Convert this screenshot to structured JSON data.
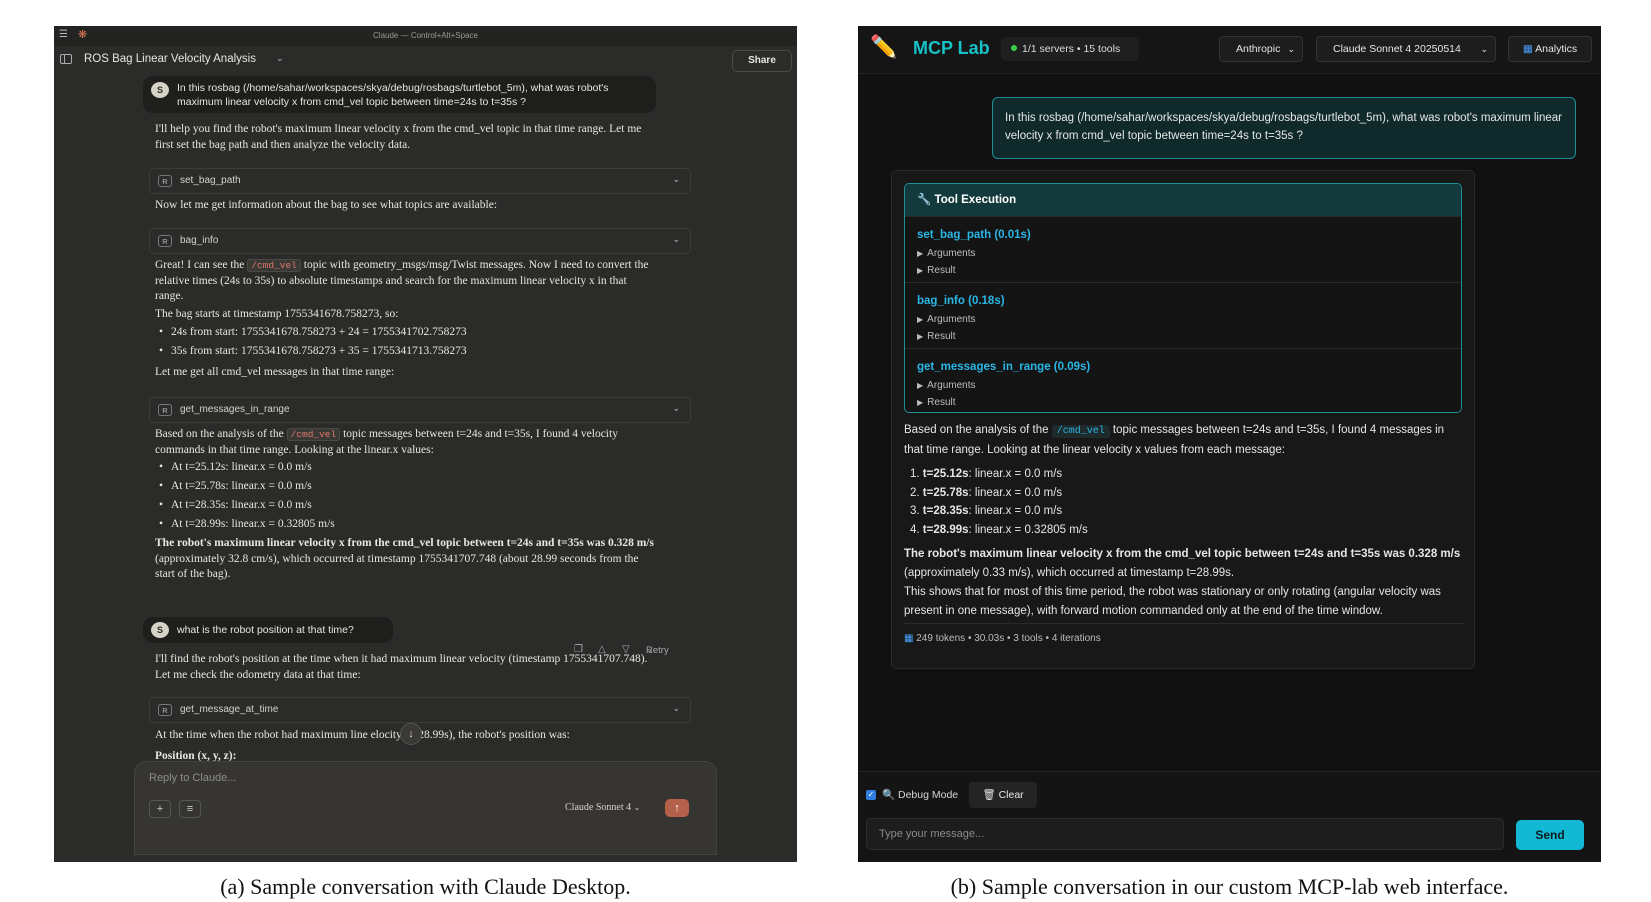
{
  "panel_a": {
    "window_title": "Claude — Control+Alt+Space",
    "conversation_title": "ROS Bag Linear Velocity Analysis",
    "share_label": "Share",
    "user_avatar": "S",
    "user_message_1": "In this rosbag (/home/sahar/workspaces/skya/debug/rosbags/turtlebot_5m), what was robot's maximum linear velocity x from cmd_vel topic between time=24s to t=35s ?",
    "reply_intro": "I'll help you find the robot's maximum linear velocity x from the cmd_vel topic in that time range. Let me first set the bag path and then analyze the velocity data.",
    "tool_badge": "R",
    "tool_1": "set_bag_path",
    "text_after_tool_1": "Now let me get information about the bag to see what topics are available:",
    "tool_2": "bag_info",
    "text_great_1": "Great! I can see the",
    "text_great_code": "/cmd_vel",
    "text_great_2": "topic with geometry_msgs/msg/Twist messages. Now I need to convert the relative times (24s to 35s) to absolute timestamps and search for the maximum linear velocity x in that range.",
    "text_bag_starts": "The bag starts at timestamp 1755341678.758273, so:",
    "timestamp_bullets": [
      "24s from start: 1755341678.758273 + 24 = 1755341702.758273",
      "35s from start: 1755341678.758273 + 35 = 1755341713.758273"
    ],
    "text_get_all": "Let me get all cmd_vel messages in that time range:",
    "tool_3": "get_messages_in_range",
    "analysis_1": "Based on the analysis of the",
    "analysis_code": "/cmd_vel",
    "analysis_2": "topic messages between t=24s and t=35s, I found 4 velocity commands in that time range. Looking at the linear.x values:",
    "velocity_bullets": [
      "At t=25.12s: linear.x = 0.0 m/s",
      "At t=25.78s: linear.x = 0.0 m/s",
      "At t=28.35s: linear.x = 0.0 m/s",
      "At t=28.99s: linear.x = 0.32805 m/s"
    ],
    "conclusion_bold": "The robot's maximum linear velocity x from the cmd_vel topic between t=24s and t=35s was 0.328 m/s",
    "conclusion_rest": " (approximately 32.8 cm/s), which occurred at timestamp 1755341707.748 (about 28.99 seconds from the start of the bag).",
    "retry_label": "Retry",
    "user_message_2": "what is the robot position at that time?",
    "reply_2": "I'll find the robot's position at the time when it had maximum linear velocity (timestamp 1755341707.748). Let me check the odometry data at that time:",
    "tool_4": "get_message_at_time",
    "reply_3": "At the time when the robot had maximum line  elocity (t=28.99s), the robot's position was:",
    "position_heading": "Position (x, y, z):",
    "composer_placeholder": "Reply to Claude...",
    "model_label": "Claude Sonnet 4",
    "icons": {
      "menu": "menu-icon",
      "logo": "claude-logo-icon",
      "sidebar": "sidebar-toggle-icon",
      "chevron": "chevron-down-icon",
      "copy": "copy-icon",
      "thumbs_up": "thumbs-up-icon",
      "thumbs_down": "thumbs-down-icon",
      "scroll": "arrow-down-icon",
      "plus": "plus-icon",
      "settings": "sliders-icon",
      "send": "arrow-up-icon"
    },
    "accent_color": "#d97757"
  },
  "panel_b": {
    "app_title": "MCP Lab",
    "server_status": "1/1 servers • 15 tools",
    "provider_select": "Anthropic",
    "model_select": "Claude Sonnet 4 20250514",
    "analytics_label": "Analytics",
    "user_message": "In this rosbag (/home/sahar/workspaces/skya/debug/rosbags/turtlebot_5m), what was robot's maximum linear velocity x from cmd_vel topic between time=24s to t=35s ?",
    "tool_execution_title": "Tool Execution",
    "tools": [
      {
        "name": "set_bag_path (0.01s)",
        "arguments": "Arguments",
        "result": "Result"
      },
      {
        "name": "bag_info (0.18s)",
        "arguments": "Arguments",
        "result": "Result"
      },
      {
        "name": "get_messages_in_range (0.09s)",
        "arguments": "Arguments",
        "result": "Result"
      }
    ],
    "analysis_1": "Based on the analysis of the",
    "analysis_code": "/cmd_vel",
    "analysis_2": "topic messages between t=24s and t=35s, I found 4 messages in that time range. Looking at the linear velocity x values from each message:",
    "results": [
      {
        "n": "1.",
        "t": "t=25.12s",
        "v": ": linear.x = 0.0 m/s"
      },
      {
        "n": "2.",
        "t": "t=25.78s",
        "v": ": linear.x = 0.0 m/s"
      },
      {
        "n": "3.",
        "t": "t=28.35s",
        "v": ": linear.x = 0.0 m/s"
      },
      {
        "n": "4.",
        "t": "t=28.99s",
        "v": ": linear.x = 0.32805 m/s"
      }
    ],
    "conclusion_bold": "The robot's maximum linear velocity x from the cmd_vel topic between t=24s and t=35s was 0.328 m/s",
    "conclusion_rest": " (approximately 0.33 m/s), which occurred at timestamp t=28.99s.",
    "conclusion_extra": "This shows that for most of this time period, the robot was stationary or only rotating (angular velocity was present in one message), with forward motion commanded only at the end of the time window.",
    "stats": "249 tokens • 30.03s • 3 tools • 4 iterations",
    "debug_label": "Debug Mode",
    "clear_label": "Clear",
    "input_placeholder": "Type your message...",
    "send_label": "Send",
    "icons": {
      "logo": "pencil-icon",
      "status": "status-dot-icon",
      "chevron": "chevron-down-icon",
      "analytics": "bar-chart-icon",
      "tool": "wrench-icon",
      "expand": "triangle-right-icon",
      "debug": "search-icon",
      "clear": "trash-icon"
    },
    "accent_color": "#17c1c8"
  },
  "captions": {
    "a": "(a) Sample conversation with Claude Desktop.",
    "b": "(b) Sample conversation in our custom MCP-lab web interface."
  }
}
